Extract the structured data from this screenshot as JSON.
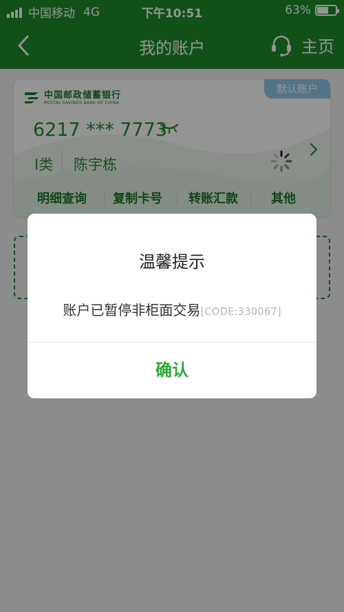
{
  "status_bar": {
    "carrier": "中国移动",
    "network": "4G",
    "time": "下午10:51",
    "battery": "63%",
    "battery_level": 0.63
  },
  "nav": {
    "title": "我的账户",
    "home_label": "主页",
    "back_icon": "chevron-left-icon",
    "service_icon": "headset-icon"
  },
  "card": {
    "bank_name_cn": "中国邮政储蓄银行",
    "bank_name_en": "POSTAL SAVINGS BANK OF CHINA",
    "default_badge": "默认账户",
    "card_number": "6217 *** 7773",
    "card_type": "I类",
    "holder_name": "陈宇栋",
    "actions": [
      "明细查询",
      "复制卡号",
      "转账汇款",
      "其他"
    ]
  },
  "dialog": {
    "title": "温馨提示",
    "message": "账户已暂停非柜面交易",
    "code": "[CODE:330067]",
    "confirm_label": "确认"
  },
  "colors": {
    "brand_green": "#1e8c2a",
    "badge_blue": "#8ec9ec",
    "confirm_green": "#2aa838"
  }
}
